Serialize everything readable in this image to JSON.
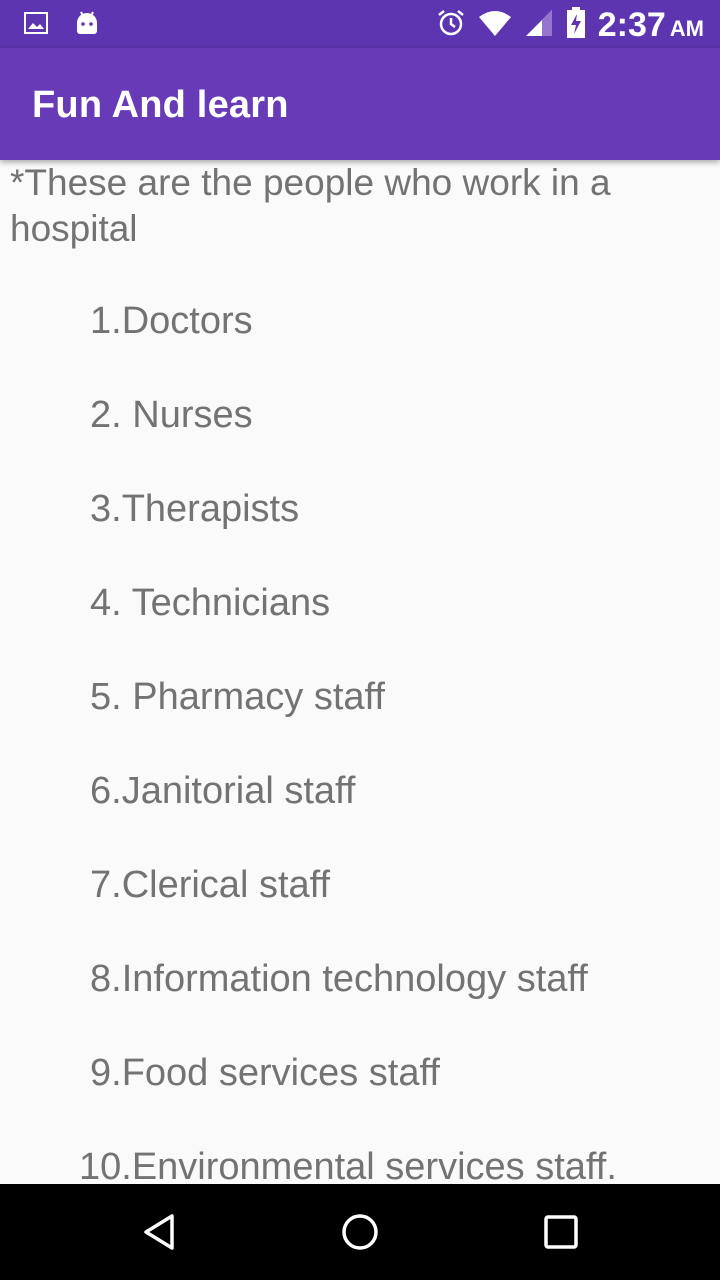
{
  "status_bar": {
    "time": "2:37",
    "ampm": "AM",
    "icons": [
      "image-icon",
      "android-icon",
      "alarm-icon",
      "wifi-icon",
      "signal-icon",
      "battery-charging-icon"
    ]
  },
  "app_bar": {
    "title": "Fun And learn"
  },
  "content": {
    "intro": "*These are the people who work in a hospital",
    "items": [
      "1.Doctors",
      "2. Nurses",
      "3.Therapists",
      "4. Technicians",
      "5. Pharmacy staff",
      "6.Janitorial staff",
      "7.Clerical staff",
      "8.Information technology staff",
      "9.Food services staff",
      "10.Environmental services staff."
    ]
  },
  "nav_bar": {
    "buttons": [
      "back-icon",
      "home-icon",
      "recents-icon"
    ]
  },
  "colors": {
    "status_bar": "#5e35b1",
    "app_bar": "#673ab7",
    "text": "#737373",
    "background": "#fafafa"
  }
}
